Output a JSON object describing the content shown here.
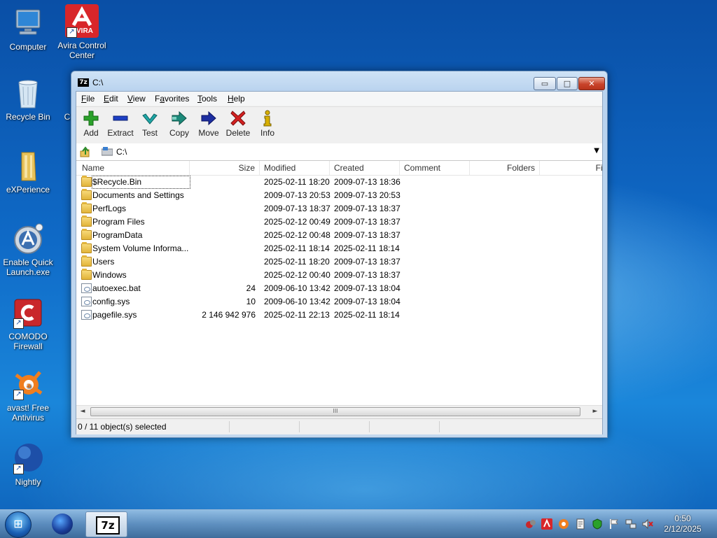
{
  "desktop": {
    "icons": [
      {
        "label": "Computer"
      },
      {
        "label": "Avira Control Center"
      },
      {
        "label": "Recycle Bin"
      },
      {
        "label": "eXPerience"
      },
      {
        "label": "Enable Quick Launch.exe"
      },
      {
        "label": "COMODO Firewall"
      },
      {
        "label": "avast! Free Antivirus"
      },
      {
        "label": "Nightly"
      }
    ],
    "avira_badge": "VIRA",
    "partial_label": "C"
  },
  "window": {
    "title": "C:\\",
    "icon_text": "7z",
    "controls": {
      "minimize": "▭",
      "maximize": "□",
      "close": "✕"
    },
    "menu": [
      {
        "pre": "",
        "u": "F",
        "post": "ile"
      },
      {
        "pre": "",
        "u": "E",
        "post": "dit"
      },
      {
        "pre": "",
        "u": "V",
        "post": "iew"
      },
      {
        "pre": "F",
        "u": "a",
        "post": "vorites"
      },
      {
        "pre": "",
        "u": "T",
        "post": "ools"
      },
      {
        "pre": "",
        "u": "H",
        "post": "elp"
      }
    ],
    "toolbar": [
      {
        "label": "Add",
        "icon": "plus-icon",
        "color": "#2aa12a"
      },
      {
        "label": "Extract",
        "icon": "minus-icon",
        "color": "#1d3fc4"
      },
      {
        "label": "Test",
        "icon": "check-icon",
        "color": "#1fa6a6"
      },
      {
        "label": "Copy",
        "icon": "double-arrow-icon",
        "color": "#1d8a7a"
      },
      {
        "label": "Move",
        "icon": "arrow-right-icon",
        "color": "#1d2ea0"
      },
      {
        "label": "Delete",
        "icon": "x-icon",
        "color": "#d42020"
      },
      {
        "label": "Info",
        "icon": "info-icon",
        "color": "#d8b000"
      }
    ],
    "address": {
      "path": "C:\\",
      "dropdown": "▼"
    },
    "columns": [
      "Name",
      "Size",
      "Modified",
      "Created",
      "Comment",
      "Folders",
      "File"
    ],
    "rows": [
      {
        "name": "$Recycle.Bin",
        "size": "",
        "modified": "2025-02-11 18:20",
        "created": "2009-07-13 18:36",
        "type": "folder"
      },
      {
        "name": "Documents and Settings",
        "size": "",
        "modified": "2009-07-13 20:53",
        "created": "2009-07-13 20:53",
        "type": "folder"
      },
      {
        "name": "PerfLogs",
        "size": "",
        "modified": "2009-07-13 18:37",
        "created": "2009-07-13 18:37",
        "type": "folder"
      },
      {
        "name": "Program Files",
        "size": "",
        "modified": "2025-02-12 00:49",
        "created": "2009-07-13 18:37",
        "type": "folder"
      },
      {
        "name": "ProgramData",
        "size": "",
        "modified": "2025-02-12 00:48",
        "created": "2009-07-13 18:37",
        "type": "folder"
      },
      {
        "name": "System Volume Informa...",
        "size": "",
        "modified": "2025-02-11 18:14",
        "created": "2025-02-11 18:14",
        "type": "folder"
      },
      {
        "name": "Users",
        "size": "",
        "modified": "2025-02-11 18:20",
        "created": "2009-07-13 18:37",
        "type": "folder"
      },
      {
        "name": "Windows",
        "size": "",
        "modified": "2025-02-12 00:40",
        "created": "2009-07-13 18:37",
        "type": "folder"
      },
      {
        "name": "autoexec.bat",
        "size": "24",
        "modified": "2009-06-10 13:42",
        "created": "2009-07-13 18:04",
        "type": "file"
      },
      {
        "name": "config.sys",
        "size": "10",
        "modified": "2009-06-10 13:42",
        "created": "2009-07-13 18:04",
        "type": "file"
      },
      {
        "name": "pagefile.sys",
        "size": "2 146 942 976",
        "modified": "2025-02-11 22:13",
        "created": "2025-02-11 18:14",
        "type": "file"
      }
    ],
    "scrollbar": {
      "left": "◄",
      "right": "►",
      "grip": "III"
    },
    "status": "0 / 11 object(s) selected"
  },
  "taskbar": {
    "start_glyph": "⊞",
    "sevenzip_label": "7z",
    "clock": {
      "time": "0:50",
      "date": "2/12/2025"
    }
  }
}
